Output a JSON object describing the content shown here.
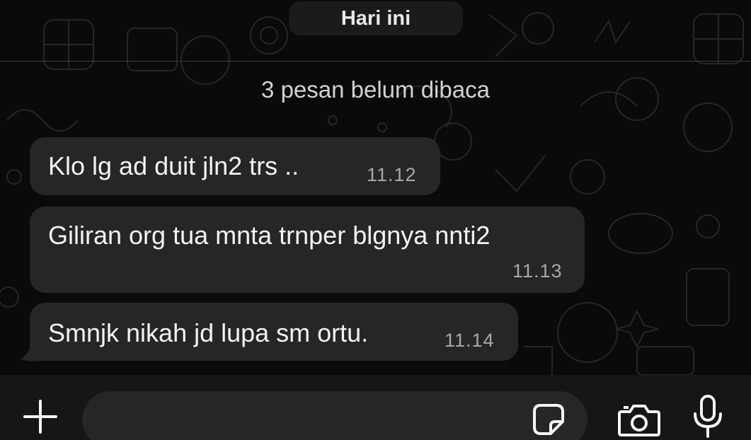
{
  "chat": {
    "date_label": "Hari ini",
    "unread_label": "3 pesan belum dibaca",
    "messages": [
      {
        "text": "Klo lg ad duit jln2 trs ..",
        "time": "11.12"
      },
      {
        "text": "Giliran org tua mnta trnper blgnya nnti2",
        "time": "11.13"
      },
      {
        "text": "Smnjk nikah jd lupa sm ortu.",
        "time": "11.14"
      }
    ]
  },
  "input_bar": {
    "message_placeholder": "",
    "icons": [
      "plus-icon",
      "sticker-icon",
      "camera-icon",
      "microphone-icon"
    ]
  },
  "colors": {
    "background": "#0a0a0a",
    "bubble": "#262626",
    "text": "#f3f3f3",
    "timestamp": "#a8a8a8",
    "input_bar": "#161616"
  }
}
